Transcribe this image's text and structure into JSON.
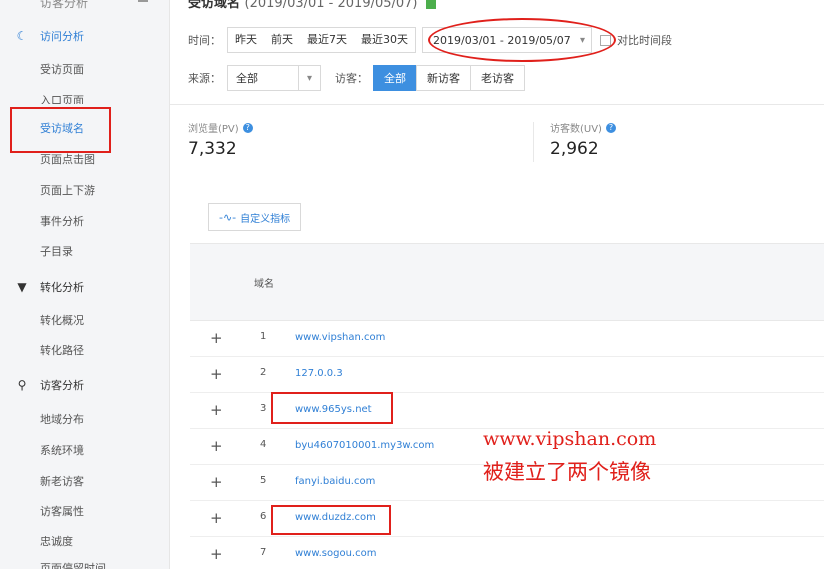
{
  "sidebar": {
    "top_label": "访客分析",
    "sections": [
      {
        "label": "访问分析",
        "icon": "crescent-icon",
        "items": [
          "受访页面",
          "入口页面",
          "受访域名",
          "页面点击图",
          "页面上下游",
          "事件分析",
          "子目录"
        ]
      },
      {
        "label": "转化分析",
        "icon": "funnel-icon",
        "items": [
          "转化概况",
          "转化路径"
        ]
      },
      {
        "label": "访客分析",
        "icon": "person-icon",
        "items": [
          "地域分布",
          "系统环境",
          "新老访客",
          "访客属性",
          "忠诚度",
          "页面停留时间"
        ]
      }
    ],
    "active_item": "受访域名"
  },
  "header": {
    "title": "受访域名",
    "range": "(2019/03/01 - 2019/05/07)"
  },
  "filters": {
    "time_label": "时间：",
    "time_options": [
      "昨天",
      "前天",
      "最近7天",
      "最近30天"
    ],
    "date_range": "2019/03/01 - 2019/05/07",
    "compare_label": "对比时间段",
    "source_label": "来源：",
    "source_value": "全部",
    "visitor_label": "访客：",
    "visitor_options": [
      "全部",
      "新访客",
      "老访客"
    ],
    "visitor_selected": "全部"
  },
  "metrics": [
    {
      "label": "浏览量(PV)",
      "value": "7,332"
    },
    {
      "label": "访客数(UV)",
      "value": "2,962"
    }
  ],
  "custom_metrics_button": "自定义指标",
  "table": {
    "column": "域名",
    "rows": [
      {
        "index": "1",
        "domain": "www.vipshan.com"
      },
      {
        "index": "2",
        "domain": "127.0.0.3"
      },
      {
        "index": "3",
        "domain": "www.965ys.net"
      },
      {
        "index": "4",
        "domain": "byu4607010001.my3w.com"
      },
      {
        "index": "5",
        "domain": "fanyi.baidu.com"
      },
      {
        "index": "6",
        "domain": "www.duzdz.com"
      },
      {
        "index": "7",
        "domain": "www.sogou.com"
      }
    ]
  },
  "annotation": {
    "line1": "www.vipshan.com",
    "line2": "被建立了两个镜像"
  }
}
